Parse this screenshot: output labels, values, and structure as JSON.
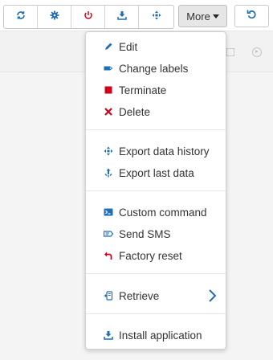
{
  "toolbar": {
    "buttons": [
      {
        "icon": "sync-icon",
        "color": "#1e6fb8"
      },
      {
        "icon": "gear-icon",
        "color": "#1e6fb8"
      },
      {
        "icon": "power-icon",
        "color": "#d0021b"
      },
      {
        "icon": "download-icon",
        "color": "#1e6fb8"
      },
      {
        "icon": "move-arrows-icon",
        "color": "#1e6fb8"
      }
    ],
    "more_label": "More",
    "refresh_icon": "undo-icon"
  },
  "menu": {
    "items": [
      {
        "label": "Edit",
        "icon": "pencil-icon"
      },
      {
        "label": "Change labels",
        "icon": "tag-icon"
      },
      {
        "label": "Terminate",
        "icon": "stop-square-icon",
        "color": "#d0021b"
      },
      {
        "label": "Delete",
        "icon": "cross-icon",
        "color": "#d0021b"
      },
      {
        "label": "Export data history",
        "icon": "export-arrows-icon"
      },
      {
        "label": "Export last data",
        "icon": "export-single-icon"
      },
      {
        "label": "Custom command",
        "icon": "terminal-icon"
      },
      {
        "label": "Send SMS",
        "icon": "sms-icon"
      },
      {
        "label": "Factory reset",
        "icon": "reset-arrow-icon",
        "color": "#d0021b"
      },
      {
        "label": "Retrieve",
        "icon": "retrieve-icon"
      },
      {
        "label": "Install application",
        "icon": "install-icon"
      }
    ]
  },
  "colors": {
    "accent": "#1e6fb8",
    "danger": "#d0021b"
  }
}
